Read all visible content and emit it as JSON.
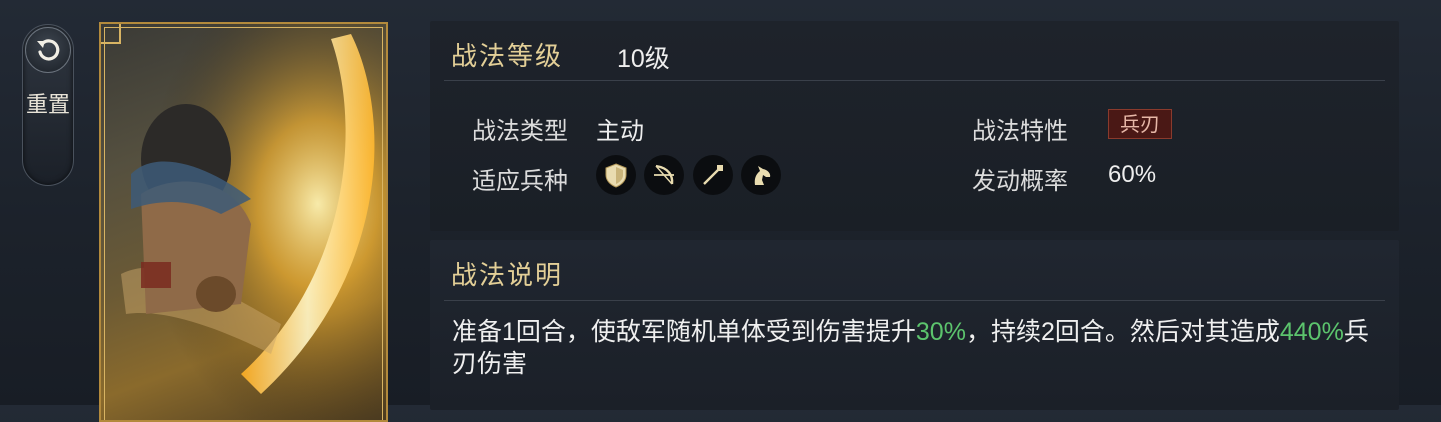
{
  "reset": {
    "label": "重置",
    "icon": "undo-arrow-icon"
  },
  "card": {
    "art": "general-with-glowing-blade"
  },
  "skill": {
    "level_title": "战法等级",
    "level_value": "10级",
    "type_label": "战法类型",
    "type_value": "主动",
    "trait_label": "战法特性",
    "trait_value": "兵刃",
    "troops_label": "适应兵种",
    "troops": [
      "shield-icon",
      "bow-icon",
      "spear-icon",
      "horse-icon"
    ],
    "rate_label": "发动概率",
    "rate_value": "60%"
  },
  "description": {
    "title": "战法说明",
    "seg1": "准备1回合，使敌军随机单体受到伤害提升",
    "hl1": "30%",
    "seg2": "，持续2回合。然后对其造成",
    "hl2": "440%",
    "seg3": "兵刃伤害"
  },
  "colors": {
    "gold": "#e3cf97",
    "highlight": "#5cc46d",
    "badge_bg": "#4a1815"
  }
}
